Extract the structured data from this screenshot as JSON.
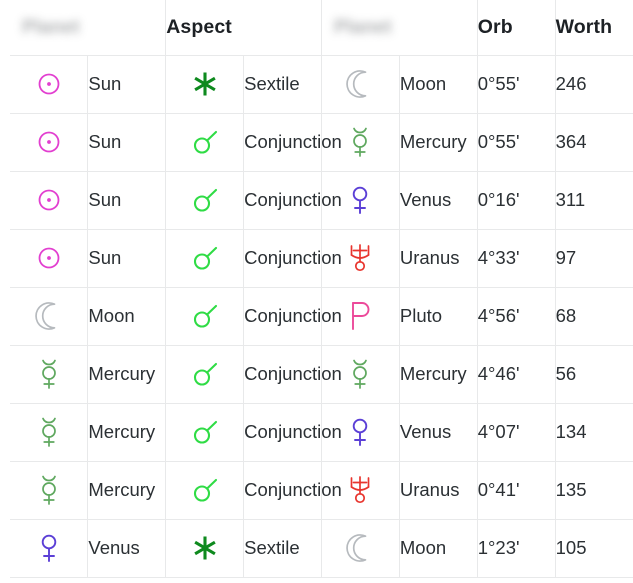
{
  "table": {
    "headers": [
      {
        "label": "",
        "redacted": true,
        "blur_text": "Planet",
        "name": "header-planet-left"
      },
      {
        "label": "Aspect",
        "redacted": false,
        "name": "header-aspect"
      },
      {
        "label": "",
        "redacted": true,
        "blur_text": "Planet",
        "name": "header-planet-right"
      },
      {
        "label": "Orb",
        "redacted": false,
        "name": "header-orb"
      },
      {
        "label": "Worth",
        "redacted": false,
        "name": "header-worth"
      }
    ],
    "rows": [
      {
        "body1_icon": "sun-symbol",
        "body1": "Sun",
        "aspect_icon": "sextile-symbol",
        "aspect": "Sextile",
        "body2_icon": "moon-symbol",
        "body2": "Moon",
        "orb": "0°55'",
        "worth": "246"
      },
      {
        "body1_icon": "sun-symbol",
        "body1": "Sun",
        "aspect_icon": "conjunction-symbol",
        "aspect": "Conjunction",
        "body2_icon": "mercury-symbol",
        "body2": "Mercury",
        "orb": "0°55'",
        "worth": "364"
      },
      {
        "body1_icon": "sun-symbol",
        "body1": "Sun",
        "aspect_icon": "conjunction-symbol",
        "aspect": "Conjunction",
        "body2_icon": "venus-symbol",
        "body2": "Venus",
        "orb": "0°16'",
        "worth": "311"
      },
      {
        "body1_icon": "sun-symbol",
        "body1": "Sun",
        "aspect_icon": "conjunction-symbol",
        "aspect": "Conjunction",
        "body2_icon": "uranus-symbol",
        "body2": "Uranus",
        "orb": "4°33'",
        "worth": "97"
      },
      {
        "body1_icon": "moon-symbol",
        "body1": "Moon",
        "aspect_icon": "conjunction-symbol",
        "aspect": "Conjunction",
        "body2_icon": "pluto-symbol",
        "body2": "Pluto",
        "orb": "4°56'",
        "worth": "68"
      },
      {
        "body1_icon": "mercury-symbol",
        "body1": "Mercury",
        "aspect_icon": "conjunction-symbol",
        "aspect": "Conjunction",
        "body2_icon": "mercury-symbol",
        "body2": "Mercury",
        "orb": "4°46'",
        "worth": "56"
      },
      {
        "body1_icon": "mercury-symbol",
        "body1": "Mercury",
        "aspect_icon": "conjunction-symbol",
        "aspect": "Conjunction",
        "body2_icon": "venus-symbol",
        "body2": "Venus",
        "orb": "4°07'",
        "worth": "134"
      },
      {
        "body1_icon": "mercury-symbol",
        "body1": "Mercury",
        "aspect_icon": "conjunction-symbol",
        "aspect": "Conjunction",
        "body2_icon": "uranus-symbol",
        "body2": "Uranus",
        "orb": "0°41'",
        "worth": "135"
      },
      {
        "body1_icon": "venus-symbol",
        "body1": "Venus",
        "aspect_icon": "sextile-symbol",
        "aspect": "Sextile",
        "body2_icon": "moon-symbol",
        "body2": "Moon",
        "orb": "1°23'",
        "worth": "105"
      }
    ]
  },
  "colors": {
    "sun": "#e23fd0",
    "moon": "#b6babe",
    "mercury": "#5fa85f",
    "venus": "#5b3fd6",
    "uranus": "#e8352e",
    "pluto": "#ec4a9a",
    "sextile": "#0e8a1e",
    "conjunction": "#2fdc45",
    "border": "#e8e9ea",
    "text": "#2b3034",
    "header_text": "#1d2125",
    "background": "#ffffff"
  }
}
